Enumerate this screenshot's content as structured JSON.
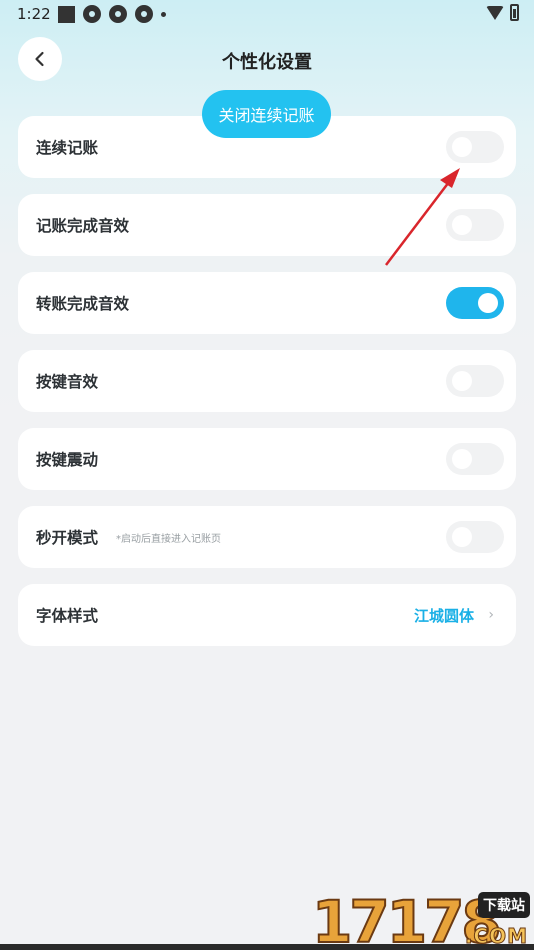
{
  "status": {
    "time": "1:22"
  },
  "header": {
    "title": "个性化设置"
  },
  "tooltip": {
    "text": "关闭连续记账"
  },
  "settings": [
    {
      "label": "连续记账",
      "toggle": false
    },
    {
      "label": "记账完成音效",
      "toggle": false
    },
    {
      "label": "转账完成音效",
      "toggle": true
    },
    {
      "label": "按键音效",
      "toggle": false
    },
    {
      "label": "按键震动",
      "toggle": false
    },
    {
      "label": "秒开模式",
      "hint": "*启动后直接进入记账页",
      "toggle": false
    }
  ],
  "font_style": {
    "label": "字体样式",
    "value": "江城圆体",
    "chevron": "›"
  },
  "watermark": {
    "digits": "17178",
    "tag": "下载站",
    "domain": ".COM"
  },
  "colors": {
    "accent": "#1fb5ec",
    "tooltip": "#23c2f0",
    "arrow": "#d9262c"
  },
  "icons": [
    "back-arrow-icon",
    "wifi-icon",
    "battery-icon"
  ]
}
